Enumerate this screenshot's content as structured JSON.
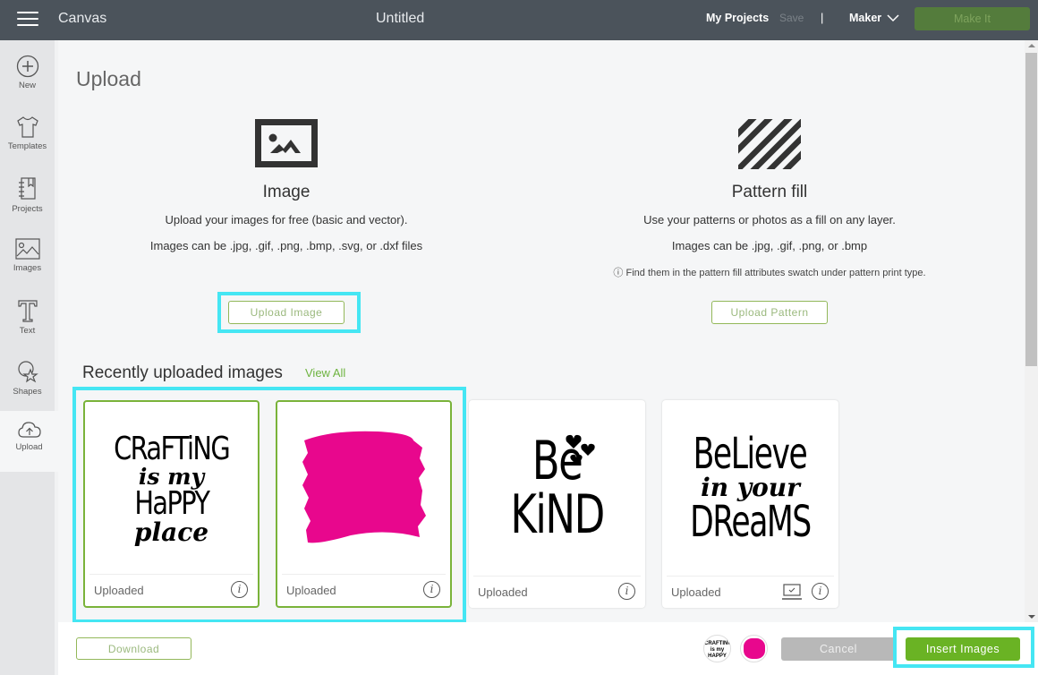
{
  "topbar": {
    "menu_icon": "hamburger-menu-icon",
    "app_name": "Canvas",
    "doc_title": "Untitled",
    "my_projects": "My Projects",
    "save": "Save",
    "divider": "|",
    "machine": "Maker",
    "make_it": "Make It",
    "make_it_color": "#547c3c"
  },
  "sidebar": {
    "items": [
      {
        "label": "New",
        "icon": "plus-circle-icon"
      },
      {
        "label": "Templates",
        "icon": "tshirt-icon"
      },
      {
        "label": "Projects",
        "icon": "notebook-icon"
      },
      {
        "label": "Images",
        "icon": "image-icon"
      },
      {
        "label": "Text",
        "icon": "text-t-icon"
      },
      {
        "label": "Shapes",
        "icon": "shapes-icon"
      },
      {
        "label": "Upload",
        "icon": "cloud-upload-icon",
        "active": true
      }
    ]
  },
  "main": {
    "title": "Upload",
    "image_section": {
      "icon": "image-icon",
      "heading": "Image",
      "line1": "Upload your images for free (basic and vector).",
      "line2": "Images can be .jpg, .gif, .png, .bmp, .svg, or .dxf files",
      "button": "Upload Image"
    },
    "pattern_section": {
      "icon": "diagonal-stripes-icon",
      "heading": "Pattern fill",
      "line1": "Use your patterns or photos as a fill on any layer.",
      "line2": "Images can be .jpg, .gif, .png, or .bmp",
      "note_icon": "ⓘ",
      "note": "Find them in the pattern fill attributes swatch under pattern print type.",
      "button": "Upload Pattern"
    },
    "recent": {
      "title": "Recently uploaded images",
      "view_all": "View All",
      "cards": [
        {
          "art": [
            "CRaFTiNG",
            "is my",
            "HaPPY",
            "place"
          ],
          "status": "Uploaded",
          "selected": true
        },
        {
          "art": "pink-brush-stroke",
          "color": "#e8078d",
          "status": "Uploaded",
          "selected": true
        },
        {
          "art": [
            "Be",
            "KiND"
          ],
          "status": "Uploaded",
          "selected": false
        },
        {
          "art": [
            "BeLieve",
            "in your",
            "DReaMS"
          ],
          "status": "Uploaded",
          "selected": false,
          "has_monitor_icon": true
        }
      ],
      "info_glyph": "i"
    }
  },
  "footer": {
    "download": "Download",
    "selected_thumbs": [
      "crafting-is-my-happy-place",
      "pink-brush-stroke"
    ],
    "cancel": "Cancel",
    "insert": "Insert Images"
  },
  "colors": {
    "accent_green": "#6ab324",
    "highlight_cyan": "#45e6f3",
    "topbar": "#4b535b",
    "pink": "#e8078d"
  }
}
